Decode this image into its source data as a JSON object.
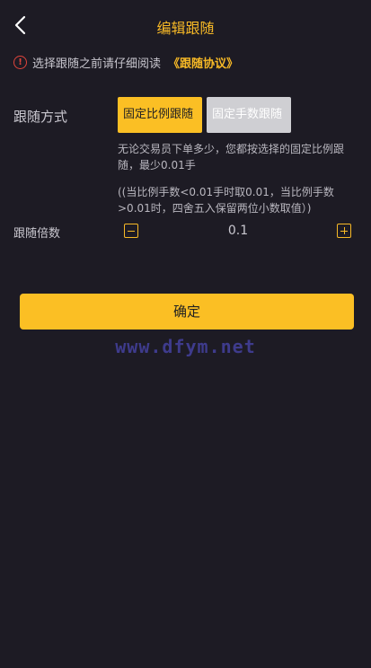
{
  "header": {
    "title": "编辑跟随",
    "back_icon": "chevron-left-icon"
  },
  "notice": {
    "icon": "warning-icon",
    "icon_glyph": "!",
    "text": "选择跟随之前请仔细阅读",
    "link_label": "《跟随协议》"
  },
  "follow_mode": {
    "label": "跟随方式",
    "options": [
      {
        "label": "固定比例跟随",
        "selected": true
      },
      {
        "label": "固定手数跟随",
        "selected": false
      }
    ],
    "description": "无论交易员下单多少，您都按选择的固定比例跟随，最少0.01手",
    "note": "((当比例手数<0.01手时取0.01，当比例手数>0.01时，四舍五入保留两位小数取值）)"
  },
  "multiplier": {
    "label": "跟随倍数",
    "value": "0.1",
    "minus_icon": "minus-icon",
    "plus_icon": "plus-icon"
  },
  "confirm_label": "确定",
  "watermark": "www.dfym.net",
  "colors": {
    "background": "#1d1b24",
    "accent": "#fbbf24",
    "inactive_button": "#cfcfd3",
    "warning": "#e0443c",
    "watermark": "#3e3b8c"
  }
}
